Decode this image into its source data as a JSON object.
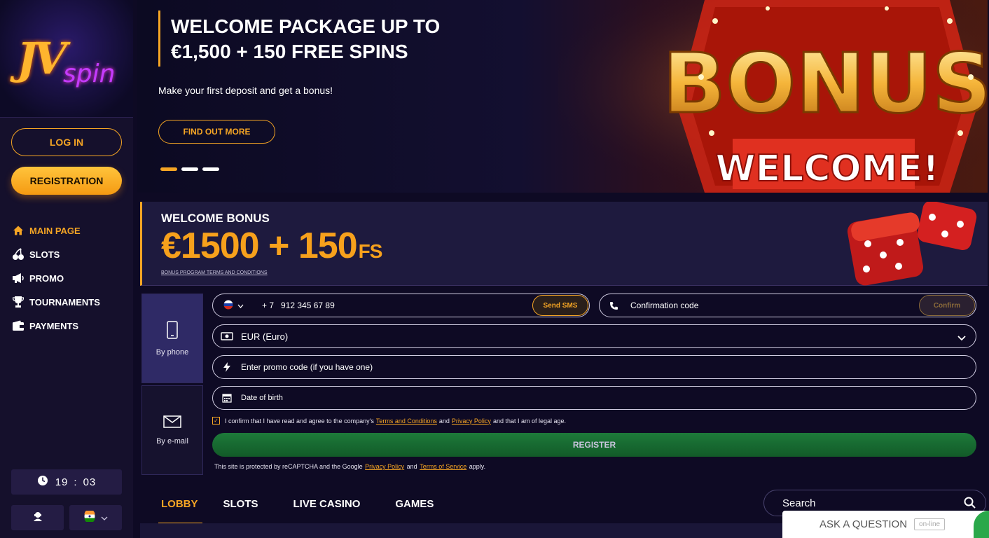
{
  "brand": {
    "logo_text_main": "JV",
    "logo_text_sub": "spin"
  },
  "sidebar": {
    "login_label": "LOG IN",
    "register_label": "REGISTRATION",
    "items": [
      {
        "label": "MAIN PAGE",
        "icon": "home-icon",
        "active": true
      },
      {
        "label": "SLOTS",
        "icon": "cherry-icon"
      },
      {
        "label": "PROMO",
        "icon": "megaphone-icon"
      },
      {
        "label": "TOURNAMENTS",
        "icon": "trophy-icon"
      },
      {
        "label": "PAYMENTS",
        "icon": "wallet-icon"
      }
    ],
    "clock": {
      "hours": "19",
      "separator": ":",
      "minutes": "03"
    }
  },
  "hero": {
    "title": "WELCOME PACKAGE UP TO €1,500 + 150 FREE SPINS",
    "subtitle": "Make your first deposit and get a bonus!",
    "cta_label": "FIND OUT MORE",
    "slides_count": 3,
    "active_slide": 1,
    "art_text_top": "BONUS",
    "art_text_bottom": "WELCOME!"
  },
  "bonus": {
    "label": "WELCOME BONUS",
    "amount": "€1500 + 150",
    "amount_suffix": "FS",
    "terms_link": "BONUS PROGRAM TERMS AND CONDITIONS"
  },
  "registration": {
    "tabs": [
      {
        "label": "By phone",
        "icon": "phone-icon",
        "active": true
      },
      {
        "label": "By e-mail",
        "icon": "mail-icon"
      }
    ],
    "phone_prefix": "+ 7",
    "phone_value": "912 345 67 89",
    "send_sms_label": "Send SMS",
    "confirmation_placeholder": "Confirmation code",
    "confirm_label": "Confirm",
    "currency_value": "EUR (Euro)",
    "promo_placeholder": "Enter promo code (if you have one)",
    "dob_placeholder": "Date of birth",
    "agree_prefix": "I confirm that I have read and agree to the company's",
    "terms_link": "Terms and Conditions",
    "and_text": "and",
    "privacy_link": "Privacy Policy",
    "agree_suffix": "and that I am of legal age.",
    "register_label": "REGISTER",
    "captcha_prefix": "This site is protected by reCAPTCHA and the Google",
    "captcha_privacy": "Privacy Policy",
    "captcha_and": "and",
    "captcha_terms": "Terms of Service",
    "captcha_suffix": "apply."
  },
  "game_tabs": [
    {
      "label": "LOBBY",
      "active": true
    },
    {
      "label": "SLOTS"
    },
    {
      "label": "LIVE CASINO"
    },
    {
      "label": "GAMES"
    }
  ],
  "search": {
    "placeholder": "Search"
  },
  "support": {
    "label": "ASK A QUESTION",
    "status": "on-line"
  },
  "colors": {
    "accent": "#f5a524",
    "background": "#0e0a24",
    "register_green": "#1d7a3a"
  }
}
